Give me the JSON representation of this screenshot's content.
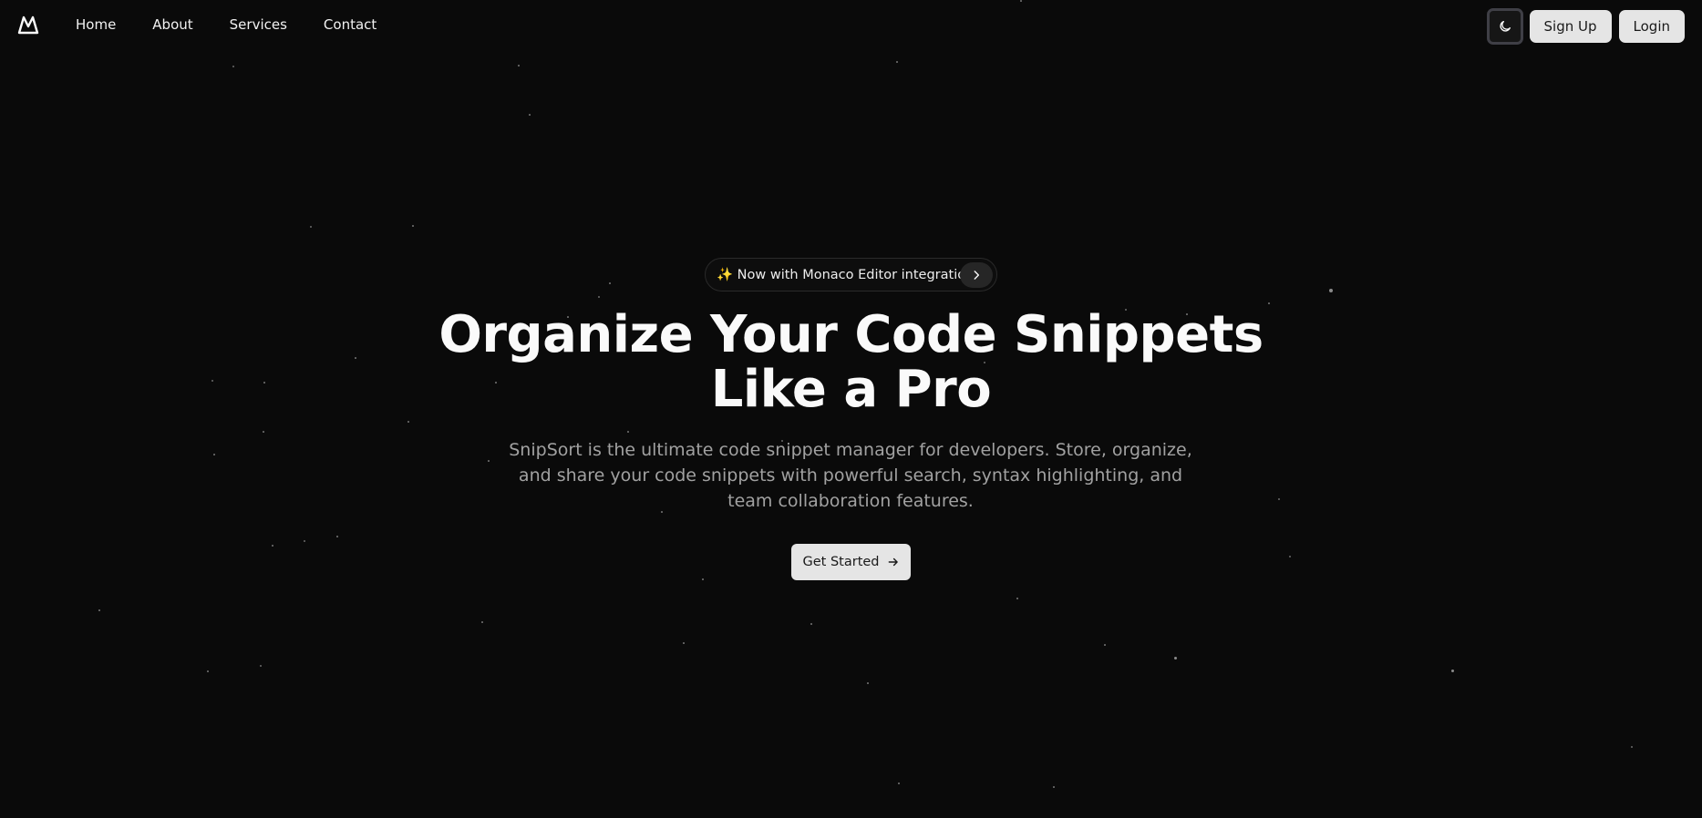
{
  "header": {
    "logo_icon": "mountain-logo-icon",
    "nav": [
      {
        "label": "Home"
      },
      {
        "label": "About"
      },
      {
        "label": "Services"
      },
      {
        "label": "Contact"
      }
    ],
    "theme_toggle_icon": "moon-icon",
    "signup_label": "Sign Up",
    "login_label": "Login"
  },
  "hero": {
    "badge_text": "✨ Now with Monaco Editor integration",
    "badge_icon": "chevron-right-icon",
    "title_line1": "Organize Your Code Snippets",
    "title_line2": "Like a Pro",
    "description": "SnipSort is the ultimate code snippet manager for developers. Store, organize, and share your code snippets with powerful search, syntax highlighting, and team collaboration features.",
    "cta_label": "Get Started",
    "cta_icon": "arrow-right-icon"
  },
  "colors": {
    "background": "#0a0a0a",
    "text": "#fafafa",
    "muted_text": "#a1a1a1",
    "button_bg": "#e5e5e5",
    "button_text": "#1a1a1a"
  }
}
